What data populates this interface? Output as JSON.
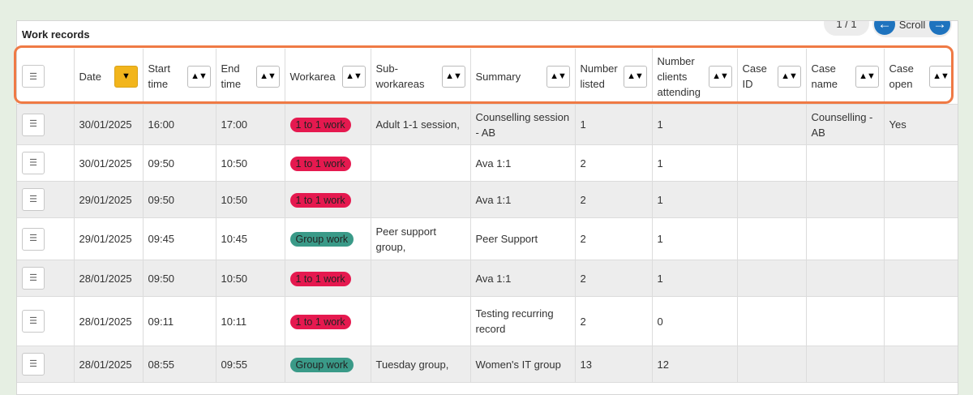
{
  "title": "Work records",
  "pager": "1 / 1",
  "scroll_label": "Scroll",
  "icons": {
    "menu": "hamburger-icon",
    "scroll_left": "arrow-left-icon",
    "scroll_right": "arrow-right-icon",
    "sort": "sort-arrows-icon",
    "sort_active": "sort-down-icon"
  },
  "colors": {
    "highlight": "#ef7a45",
    "sort_active": "#f2b51c",
    "red_pill": "#e5194f",
    "green_pill": "#3a9a88",
    "scroll_button": "#1e73be"
  },
  "columns": [
    {
      "key": "menu",
      "label": ""
    },
    {
      "key": "date",
      "label": "Date",
      "sort": "▼",
      "active": true
    },
    {
      "key": "start",
      "label": "Start time",
      "sort": "▲▼"
    },
    {
      "key": "end",
      "label": "End time",
      "sort": "▲▼"
    },
    {
      "key": "workarea",
      "label": "Workarea",
      "sort": "▲▼"
    },
    {
      "key": "sub",
      "label": "Sub-workareas",
      "sort": "▲▼"
    },
    {
      "key": "summary",
      "label": "Summary",
      "sort": "▲▼"
    },
    {
      "key": "listed",
      "label": "Number listed",
      "sort": "▲▼"
    },
    {
      "key": "attending",
      "label": "Number clients attending",
      "sort": "▲▼"
    },
    {
      "key": "caseid",
      "label": "Case ID",
      "sort": "▲▼"
    },
    {
      "key": "casename",
      "label": "Case name",
      "sort": "▲▼"
    },
    {
      "key": "caseopen",
      "label": "Case open",
      "sort": "▲▼"
    }
  ],
  "rows": [
    {
      "date": "30/01/2025",
      "start": "16:00",
      "end": "17:00",
      "workarea": "1 to 1 work",
      "wa_color": "red",
      "sub": "Adult 1-1 session,",
      "summary": "Counselling session - AB",
      "listed": "1",
      "attending": "1",
      "caseid": "",
      "casename": "Counselling - AB",
      "caseopen": "Yes"
    },
    {
      "date": "30/01/2025",
      "start": "09:50",
      "end": "10:50",
      "workarea": "1 to 1 work",
      "wa_color": "red",
      "sub": "",
      "summary": "Ava 1:1",
      "listed": "2",
      "attending": "1",
      "caseid": "",
      "casename": "",
      "caseopen": ""
    },
    {
      "date": "29/01/2025",
      "start": "09:50",
      "end": "10:50",
      "workarea": "1 to 1 work",
      "wa_color": "red",
      "sub": "",
      "summary": "Ava 1:1",
      "listed": "2",
      "attending": "1",
      "caseid": "",
      "casename": "",
      "caseopen": ""
    },
    {
      "date": "29/01/2025",
      "start": "09:45",
      "end": "10:45",
      "workarea": "Group work",
      "wa_color": "green",
      "sub": "Peer support group,",
      "summary": "Peer Support",
      "listed": "2",
      "attending": "1",
      "caseid": "",
      "casename": "",
      "caseopen": ""
    },
    {
      "date": "28/01/2025",
      "start": "09:50",
      "end": "10:50",
      "workarea": "1 to 1 work",
      "wa_color": "red",
      "sub": "",
      "summary": "Ava 1:1",
      "listed": "2",
      "attending": "1",
      "caseid": "",
      "casename": "",
      "caseopen": ""
    },
    {
      "date": "28/01/2025",
      "start": "09:11",
      "end": "10:11",
      "workarea": "1 to 1 work",
      "wa_color": "red",
      "sub": "",
      "summary": "Testing recurring record",
      "listed": "2",
      "attending": "0",
      "caseid": "",
      "casename": "",
      "caseopen": ""
    },
    {
      "date": "28/01/2025",
      "start": "08:55",
      "end": "09:55",
      "workarea": "Group work",
      "wa_color": "green",
      "sub": "Tuesday group,",
      "summary": "Women's IT group",
      "listed": "13",
      "attending": "12",
      "caseid": "",
      "casename": "",
      "caseopen": ""
    }
  ]
}
